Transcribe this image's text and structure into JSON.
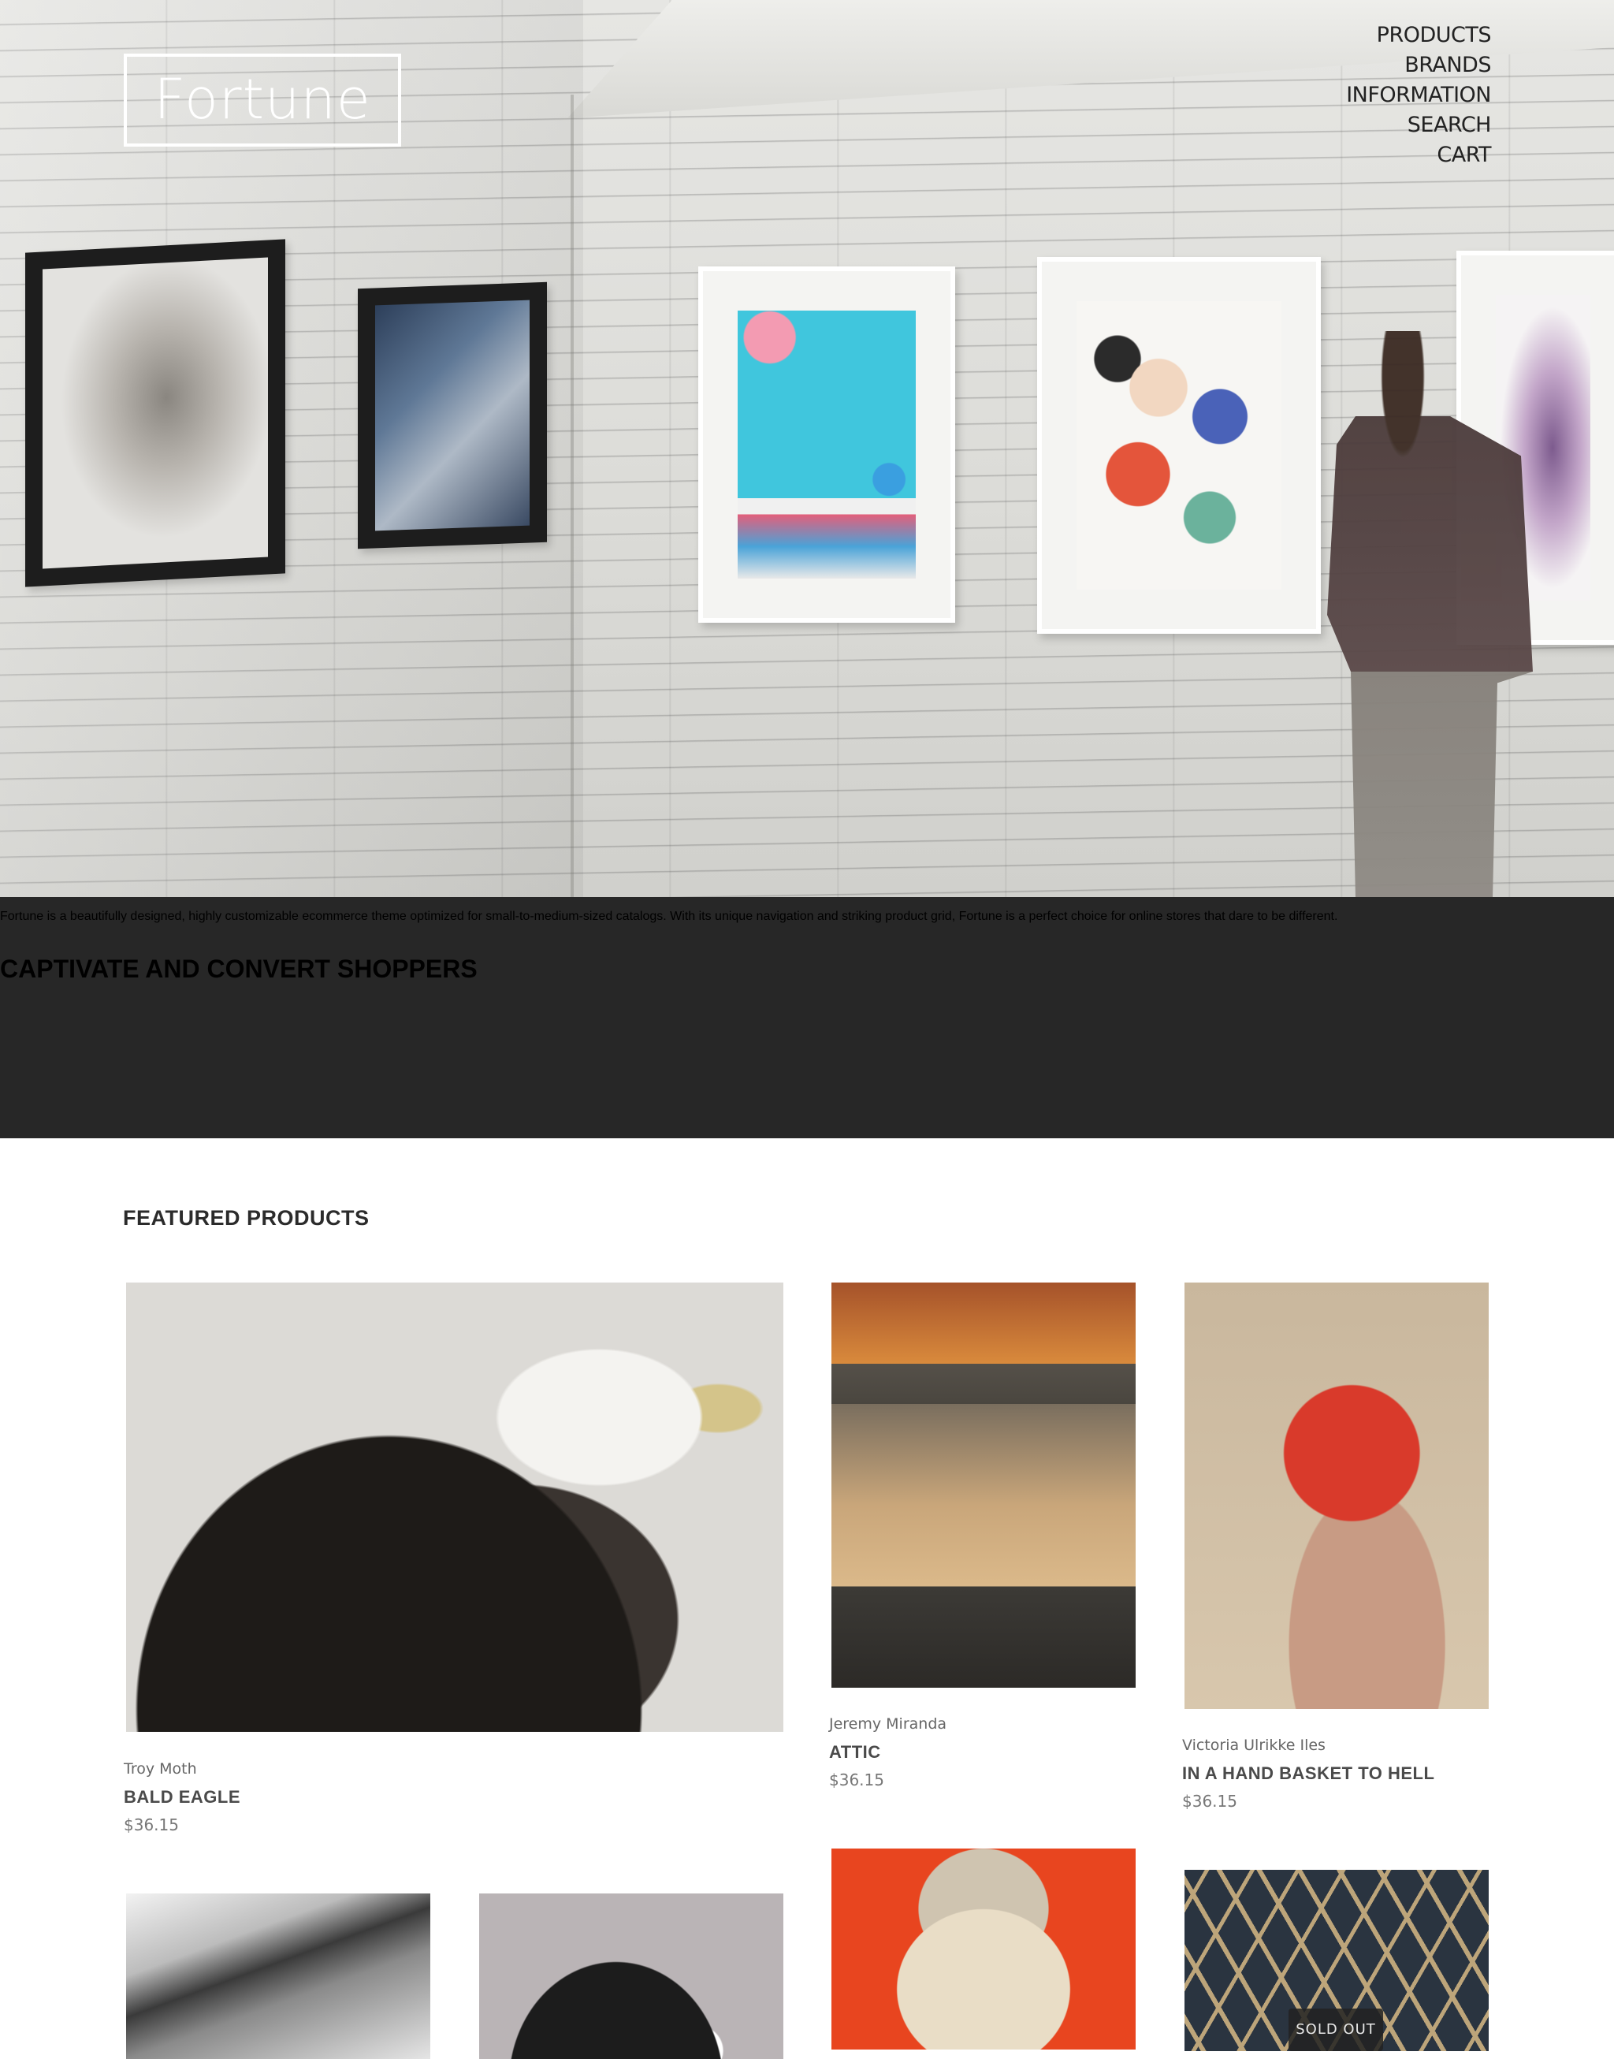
{
  "logo": {
    "text": "Fortune"
  },
  "nav": {
    "items": [
      "PRODUCTS",
      "BRANDS",
      "INFORMATION",
      "SEARCH",
      "CART"
    ]
  },
  "intro": {
    "heading": "CAPTIVATE AND CONVERT SHOPPERS",
    "body": "Fortune is a beautifully designed, highly customizable ecommerce theme optimized for small-to-medium-sized catalogs. With its unique navigation and striking product grid, Fortune is a perfect choice for online stores that dare to be different."
  },
  "featured": {
    "heading": "FEATURED PRODUCTS",
    "products": [
      {
        "artist": "Troy Moth",
        "title": "BALD EAGLE",
        "price": "$36.15"
      },
      {
        "artist": "Jeremy Miranda",
        "title": "ATTIC",
        "price": "$36.15"
      },
      {
        "artist": "Victoria Ulrikke Iles",
        "title": "IN A HAND BASKET TO HELL",
        "price": "$36.15"
      }
    ],
    "sold_out_label": "SOLD OUT"
  },
  "colors": {
    "band_background": "#272727",
    "heading_text": "#2b2b2b",
    "sold_badge": "#222222"
  }
}
